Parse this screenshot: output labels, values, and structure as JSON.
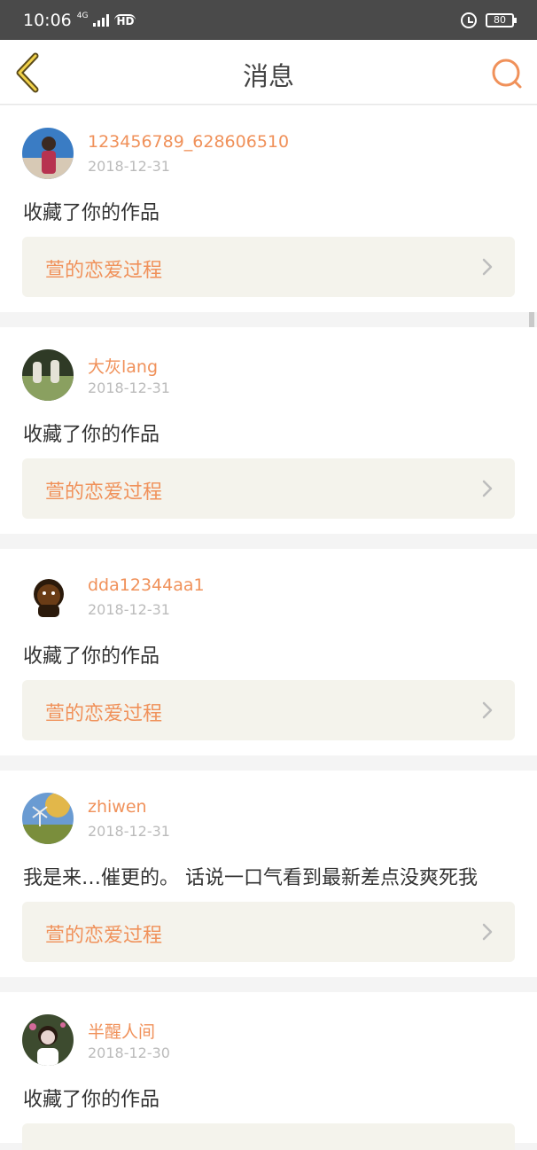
{
  "status_bar": {
    "time": "10:06",
    "network": "4G",
    "hd": "HD",
    "battery": "80"
  },
  "nav": {
    "title": "消息"
  },
  "messages": [
    {
      "username": "123456789_628606510",
      "date": "2018-12-31",
      "action": "收藏了你的作品",
      "work_title": "萱的恋爱过程",
      "avatar_colors": [
        "#3a7cc4",
        "#d7c9b5",
        "#b73250"
      ]
    },
    {
      "username": "大灰lang",
      "date": "2018-12-31",
      "action": "收藏了你的作品",
      "work_title": "萱的恋爱过程",
      "avatar_colors": [
        "#2f3a26",
        "#8aa060",
        "#e5e2d7"
      ]
    },
    {
      "username": "dda12344aa1",
      "date": "2018-12-31",
      "action": "收藏了你的作品",
      "work_title": "萱的恋爱过程",
      "avatar_colors": [
        "#ffffff",
        "#6a3c16",
        "#2b1a0b"
      ]
    },
    {
      "username": "zhiwen",
      "date": "2018-12-31",
      "action": "我是来…催更的。 话说一口气看到最新差点没爽死我",
      "work_title": "萱的恋爱过程",
      "avatar_colors": [
        "#6a9bd2",
        "#e2b74a",
        "#7a8e3c"
      ]
    },
    {
      "username": "半醒人间",
      "date": "2018-12-30",
      "action": "收藏了你的作品",
      "work_title": "",
      "avatar_colors": [
        "#3d4b2f",
        "#e8d4d0",
        "#ffffff"
      ]
    }
  ],
  "accent_color": "#f0915a"
}
